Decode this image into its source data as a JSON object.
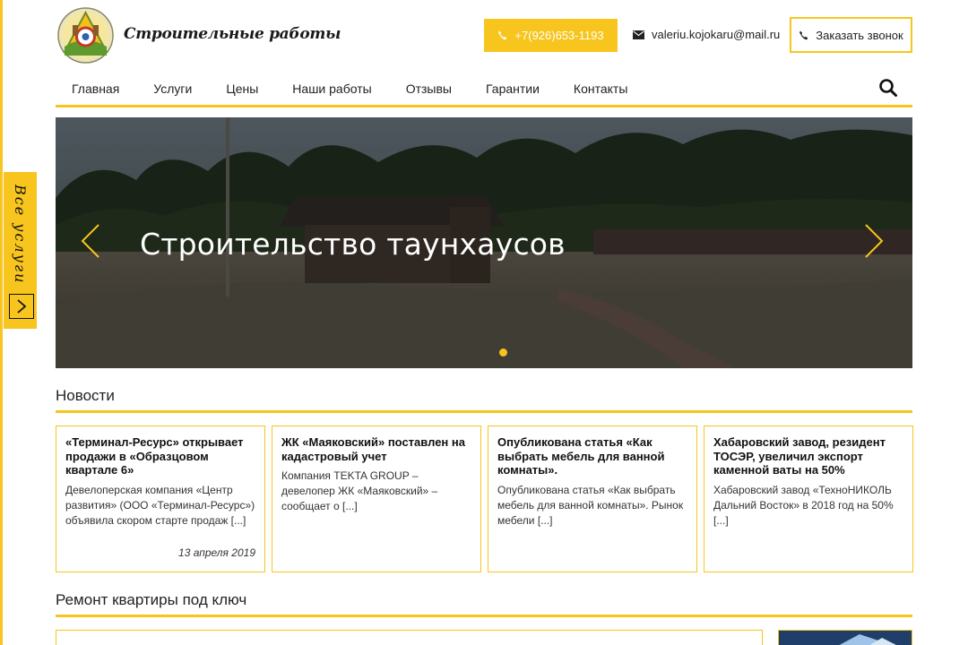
{
  "site": {
    "title": "Строительные работы",
    "phone": "+7(926)653-1193",
    "email": "valeriu.kojokaru@mail.ru",
    "callback_label": "Заказать звонок"
  },
  "side_tab": {
    "label": "Все услуги"
  },
  "nav": {
    "items": [
      {
        "label": "Главная"
      },
      {
        "label": "Услуги"
      },
      {
        "label": "Цены"
      },
      {
        "label": "Наши работы"
      },
      {
        "label": "Отзывы"
      },
      {
        "label": "Гарантии"
      },
      {
        "label": "Контакты"
      }
    ]
  },
  "slider": {
    "title": "Строительство таунхаусов",
    "slides_count": 1,
    "active_slide": 1
  },
  "news": {
    "heading": "Новости",
    "items": [
      {
        "title": "«Терминал-Ресурс» открывает продажи в «Образцовом квартале 6»",
        "text": "Девелоперская компания «Центр развития» (ООО «Терминал-Ресурс») объявила скором старте продаж [...]",
        "date": "13 апреля 2019"
      },
      {
        "title": "ЖК «Маяковский» поставлен на кадастровый учет",
        "text": "Компания TEKTA GROUP – девелопер ЖК «Маяковский» – сообщает о [...]",
        "date": ""
      },
      {
        "title": "Опубликована статья «Как выбрать мебель для ванной комнаты».",
        "text": "Опубликована статья «Как выбрать мебель для ванной комнаты». Рынок мебели [...]",
        "date": ""
      },
      {
        "title": "Хабаровский завод, резидент ТОСЭР, увеличил экспорт каменной ваты на 50%",
        "text": "Хабаровский завод «ТехноНИКОЛЬ Дальний Восток» в 2018 год на 50% [...]",
        "date": ""
      }
    ]
  },
  "repair": {
    "heading": "Ремонт квартиры под ключ"
  },
  "colors": {
    "accent": "#f7c51d",
    "text": "#222222",
    "white": "#ffffff"
  },
  "icons": {
    "phone": "phone-icon",
    "email": "envelope-icon",
    "callback": "phone-icon",
    "search": "search-icon",
    "prev": "chevron-left-icon",
    "next": "chevron-right-icon",
    "side": "chevron-right-icon"
  }
}
